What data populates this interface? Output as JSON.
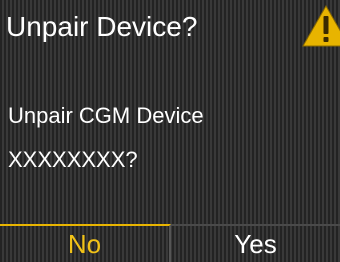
{
  "dialog": {
    "title": "Unpair Device?",
    "message_line1": "Unpair CGM Device",
    "message_line2": "XXXXXXXX?"
  },
  "icons": {
    "warning": "warning-triangle-icon"
  },
  "buttons": {
    "no_label": "No",
    "yes_label": "Yes"
  },
  "colors": {
    "accent": "#f2c318",
    "warning": "#e8b400",
    "text": "#ffffff"
  }
}
